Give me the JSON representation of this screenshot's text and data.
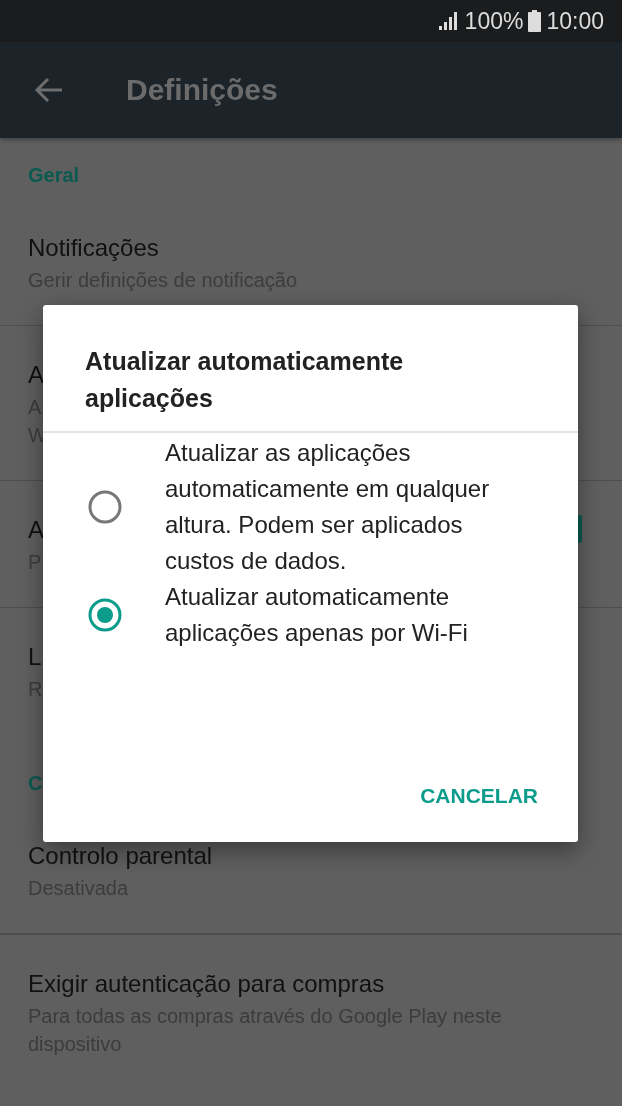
{
  "status_bar": {
    "battery": "100%",
    "time": "10:00"
  },
  "app_bar": {
    "title": "Definições"
  },
  "sections": [
    {
      "header": "Geral",
      "items": [
        {
          "title": "Notificações",
          "subtitle": [
            "Gerir definições de notificação"
          ]
        },
        {
          "title": "A",
          "subtitle": [
            "A",
            "W"
          ]
        },
        {
          "title": "A",
          "subtitle": [
            "P"
          ],
          "kind": "switch",
          "on": true
        },
        {
          "title": "L",
          "subtitle": [
            "R"
          ]
        }
      ]
    },
    {
      "header": "C",
      "items": [
        {
          "title": "Controlo parental",
          "subtitle": [
            "Desativada"
          ]
        },
        {
          "title": "Exigir autenticação para compras",
          "subtitle": [
            "Para todas as compras através do Google Play neste dispositivo"
          ]
        }
      ]
    }
  ],
  "dialog": {
    "title": "Atualizar automaticamente aplicações",
    "options": [
      {
        "label": "Atualizar as aplicações automaticamente em qualquer altura. Podem ser aplicados custos de dados.",
        "selected": false
      },
      {
        "label": "Atualizar automaticamente aplicações apenas por Wi-Fi",
        "selected": true
      }
    ],
    "buttons": [
      "CANCELAR"
    ]
  }
}
